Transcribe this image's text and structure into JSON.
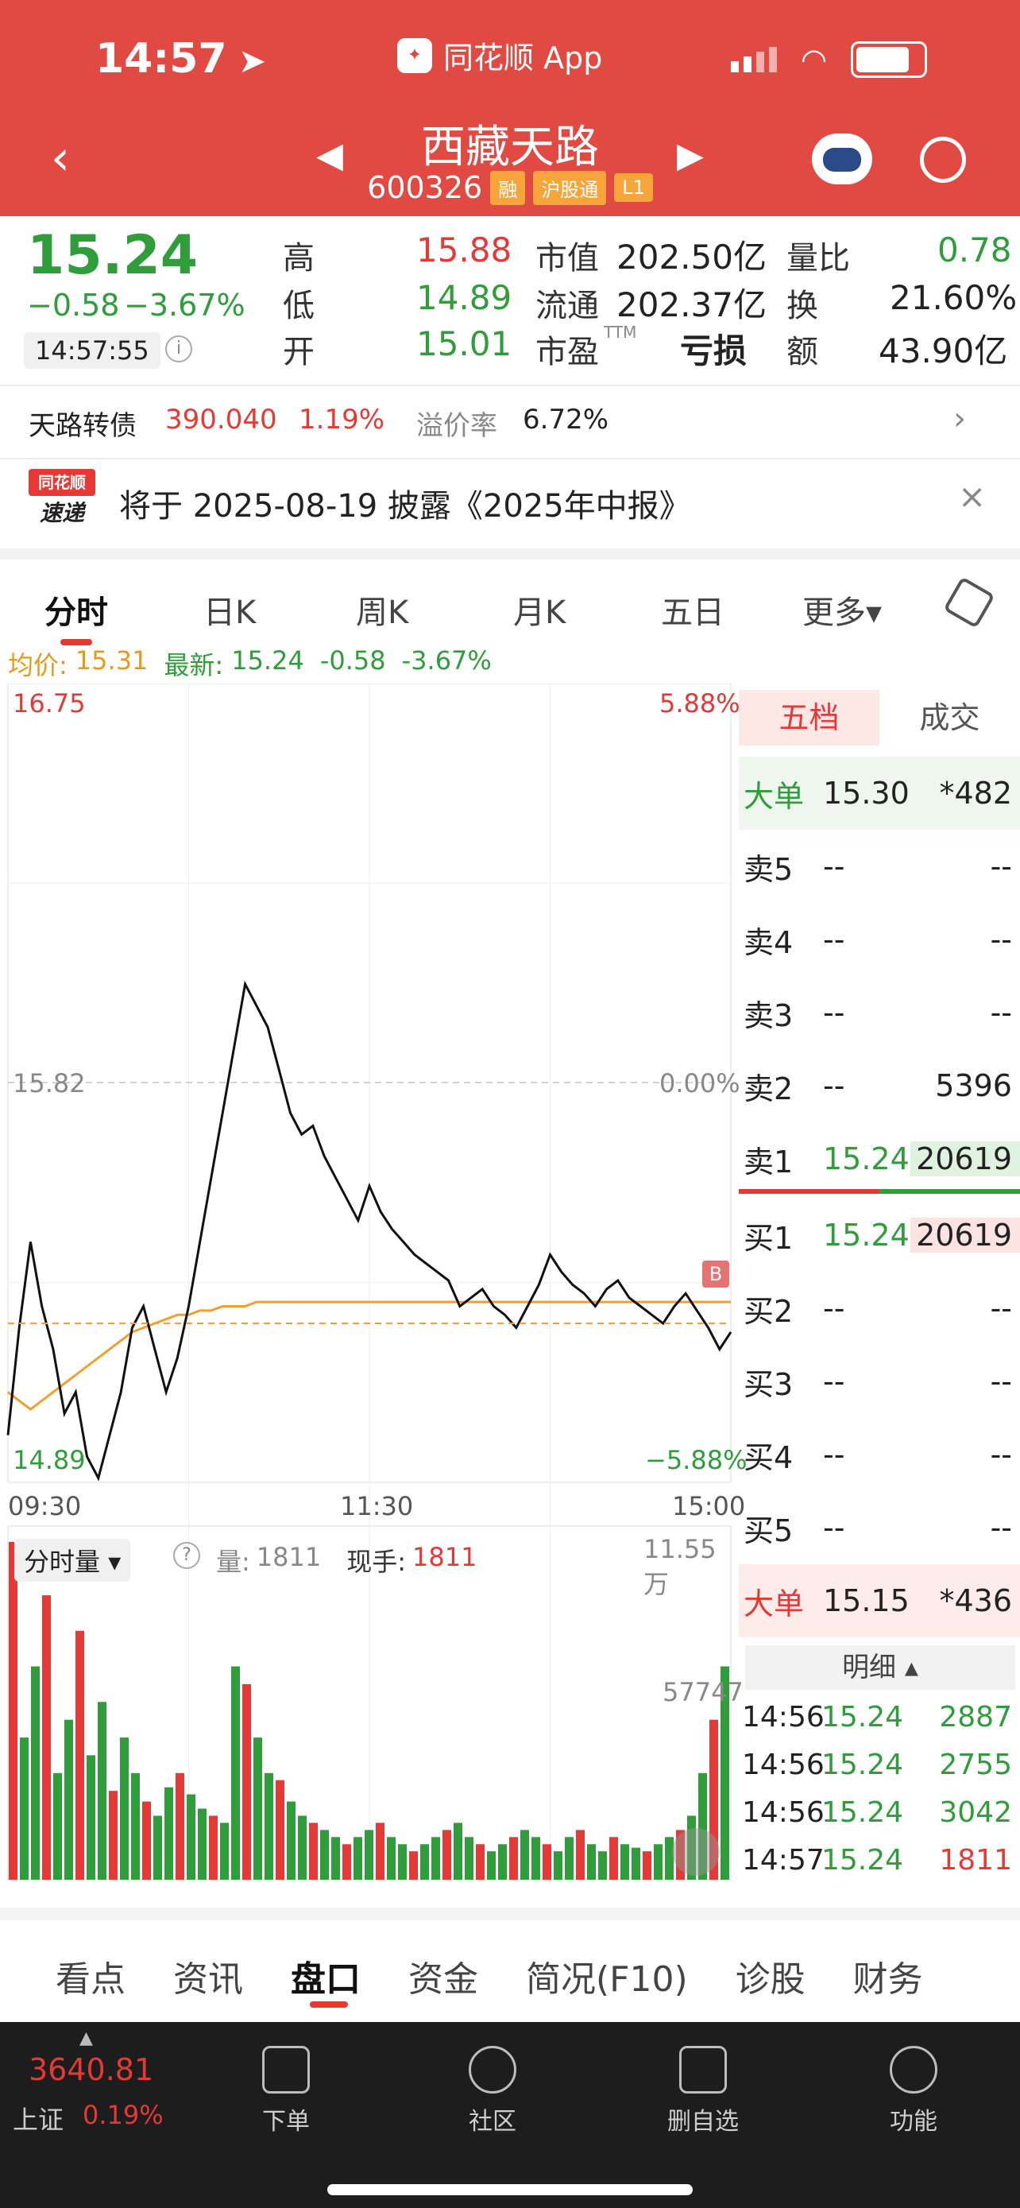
{
  "status": {
    "time": "14:57",
    "app_label": "同花顺 App"
  },
  "stock": {
    "name": "西藏天路",
    "code": "600326",
    "tags": [
      "融",
      "沪股通",
      "L1"
    ]
  },
  "quote": {
    "price": "15.24",
    "change": "−0.58",
    "change_pct": "−3.67%",
    "timestamp": "14:57:55",
    "high_label": "高",
    "high": "15.88",
    "low_label": "低",
    "low": "14.89",
    "open_label": "开",
    "open": "15.01",
    "mcap_label": "市值",
    "mcap": "202.50亿",
    "float_label": "流通",
    "float": "202.37亿",
    "pe_label": "市盈",
    "pe_sup": "TTM",
    "pe": "亏损",
    "vr_label": "量比",
    "vr": "0.78",
    "turn_label": "换",
    "turn": "21.60%",
    "amt_label": "额",
    "amt": "43.90亿"
  },
  "bond": {
    "name": "天路转债",
    "price": "390.040",
    "pct": "1.19%",
    "premium_label": "溢价率",
    "premium": "6.72%"
  },
  "notice": {
    "logo_top": "同花顺",
    "logo_bottom": "速递",
    "text": "将于 2025-08-19 披露《2025年中报》"
  },
  "tabs": [
    {
      "label": "分时"
    },
    {
      "label": "日K"
    },
    {
      "label": "周K"
    },
    {
      "label": "月K"
    },
    {
      "label": "五日"
    },
    {
      "label": "更多▾"
    }
  ],
  "chart_info": {
    "avg_label": "均价:",
    "avg": "15.31",
    "latest_label": "最新:",
    "latest": "15.24",
    "chg": "-0.58",
    "pct": "-3.67%"
  },
  "chart_data": {
    "type": "line",
    "title": "",
    "x_ticks": [
      "09:30",
      "11:30",
      "15:00"
    ],
    "y_ticks": {
      "top": "16.75",
      "mid": "15.82",
      "bottom": "14.89"
    },
    "pct_ticks": {
      "top": "5.88%",
      "mid": "0.00%",
      "bottom": "−5.88%"
    },
    "ylim": [
      14.89,
      16.75
    ],
    "prev_close": 15.82,
    "series": [
      {
        "name": "",
        "values": [
          15.0,
          15.25,
          15.45,
          15.3,
          15.2,
          15.05,
          15.1,
          14.95,
          14.9,
          15.0,
          15.1,
          15.25,
          15.3,
          15.2,
          15.1,
          15.18,
          15.3,
          15.45,
          15.6,
          15.75,
          15.9,
          16.05,
          16.0,
          15.95,
          15.85,
          15.75,
          15.7,
          15.72,
          15.65,
          15.6,
          15.55,
          15.5,
          15.58,
          15.52,
          15.48,
          15.45,
          15.42,
          15.4,
          15.38,
          15.36,
          15.3,
          15.32,
          15.34,
          15.3,
          15.28,
          15.25,
          15.3,
          15.35,
          15.42,
          15.38,
          15.35,
          15.33,
          15.3,
          15.34,
          15.36,
          15.32,
          15.3,
          15.28,
          15.26,
          15.3,
          15.33,
          15.29,
          15.25,
          15.2,
          15.24
        ]
      },
      {
        "name": "",
        "values": [
          15.1,
          15.08,
          15.06,
          15.08,
          15.1,
          15.12,
          15.14,
          15.16,
          15.18,
          15.2,
          15.22,
          15.24,
          15.25,
          15.26,
          15.27,
          15.28,
          15.28,
          15.29,
          15.29,
          15.3,
          15.3,
          15.3,
          15.31,
          15.31,
          15.31,
          15.31,
          15.31,
          15.31,
          15.31,
          15.31,
          15.31,
          15.31,
          15.31,
          15.31,
          15.31,
          15.31,
          15.31,
          15.31,
          15.31,
          15.31,
          15.31,
          15.31,
          15.31,
          15.31,
          15.31,
          15.31,
          15.31,
          15.31,
          15.31,
          15.31,
          15.31,
          15.31,
          15.31,
          15.31,
          15.31,
          15.31,
          15.31,
          15.31,
          15.31,
          15.31,
          15.31,
          15.31,
          15.31,
          15.31,
          15.31
        ]
      }
    ],
    "volume": {
      "label": "分时量",
      "vol_label": "量:",
      "vol": "1811",
      "hand_label": "现手:",
      "hand": "1811",
      "top_label": "11.55万",
      "mid_label": "57747",
      "bars": [
        95,
        40,
        60,
        80,
        30,
        45,
        70,
        35,
        50,
        25,
        40,
        30,
        22,
        18,
        26,
        30,
        24,
        20,
        18,
        16,
        60,
        55,
        40,
        30,
        28,
        22,
        18,
        16,
        14,
        12,
        10,
        12,
        14,
        16,
        12,
        10,
        8,
        10,
        12,
        14,
        16,
        12,
        10,
        8,
        10,
        12,
        14,
        12,
        10,
        8,
        12,
        14,
        10,
        8,
        12,
        10,
        9,
        8,
        10,
        12,
        14,
        18,
        30,
        45,
        60
      ]
    }
  },
  "book": {
    "tabs": [
      "五档",
      "成交"
    ],
    "big_sell": {
      "label": "大单",
      "price": "15.30",
      "vol": "*482"
    },
    "asks": [
      {
        "label": "卖5",
        "price": "--",
        "vol": "--"
      },
      {
        "label": "卖4",
        "price": "--",
        "vol": "--"
      },
      {
        "label": "卖3",
        "price": "--",
        "vol": "--"
      },
      {
        "label": "卖2",
        "price": "--",
        "vol": "5396"
      },
      {
        "label": "卖1",
        "price": "15.24",
        "vol": "20619"
      }
    ],
    "bids": [
      {
        "label": "买1",
        "price": "15.24",
        "vol": "20619"
      },
      {
        "label": "买2",
        "price": "--",
        "vol": "--"
      },
      {
        "label": "买3",
        "price": "--",
        "vol": "--"
      },
      {
        "label": "买4",
        "price": "--",
        "vol": "--"
      },
      {
        "label": "买5",
        "price": "--",
        "vol": "--"
      }
    ],
    "big_buy": {
      "label": "大单",
      "price": "15.15",
      "vol": "*436"
    },
    "detail_label": "明细",
    "trades": [
      {
        "time": "14:56",
        "price": "15.24",
        "vol": "2887"
      },
      {
        "time": "14:56",
        "price": "15.24",
        "vol": "2755"
      },
      {
        "time": "14:56",
        "price": "15.24",
        "vol": "3042"
      },
      {
        "time": "14:57",
        "price": "15.24",
        "vol": "1811"
      }
    ]
  },
  "bottom_tabs": [
    {
      "label": "看点"
    },
    {
      "label": "资讯"
    },
    {
      "label": "盘口"
    },
    {
      "label": "资金"
    },
    {
      "label": "简况(F10)"
    },
    {
      "label": "诊股"
    },
    {
      "label": "财务"
    }
  ],
  "footer": {
    "index_value": "3640.81",
    "index_name": "上证",
    "index_pct": "0.19%",
    "items": [
      {
        "label": "下单"
      },
      {
        "label": "社区"
      },
      {
        "label": "删自选"
      },
      {
        "label": "功能"
      }
    ]
  },
  "colors": {
    "header_red": "#e04a43",
    "up_red": "#e53935",
    "down_green": "#2e9d3a",
    "avg_line": "#f0a030"
  }
}
